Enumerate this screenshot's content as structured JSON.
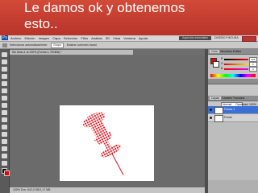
{
  "slide": {
    "caption_line1": "Le damos ok y obtenemos",
    "caption_line2": "esto.."
  },
  "app": {
    "logo": "Ps",
    "menu": [
      "Archivo",
      "Edición",
      "Imagen",
      "Capa",
      "Selección",
      "Filtro",
      "Análisis",
      "3D",
      "Vista",
      "Ventana",
      "Ayuda"
    ],
    "workspace_button": "Aspectos esenciales",
    "right_menu": "DISEÑO   PINTURA"
  },
  "options_bar": {
    "label": "Seleccionar automáticamente:",
    "dropdown": "Grupo",
    "transform_label": "Mostrar controles transf."
  },
  "document": {
    "tab_title": "Sin título-1 al 100% (Forma 1, RGB/8) *",
    "status": "100%    Doc: 642,0 KB/1,17 MB"
  },
  "color_panel": {
    "tabs": [
      "Color",
      "Muestras",
      "Estilos"
    ],
    "channels": [
      {
        "label": "R",
        "value": "225"
      },
      {
        "label": "G",
        "value": "0"
      },
      {
        "label": "B",
        "value": "0"
      }
    ],
    "fg_color": "#e00000",
    "bg_color": "#ffffff"
  },
  "layers_panel": {
    "tabs": [
      "Capas",
      "Canales",
      "Trazados"
    ],
    "blend_mode": "Normal",
    "opacity_label": "Opacidad: 100%",
    "layers": [
      {
        "name": "Forma 1",
        "active": true
      },
      {
        "name": "Fondo",
        "active": false
      }
    ]
  },
  "icons": {
    "eye": "eye-icon",
    "fg_swatch": "foreground-color-icon",
    "bg_swatch": "background-color-icon"
  }
}
